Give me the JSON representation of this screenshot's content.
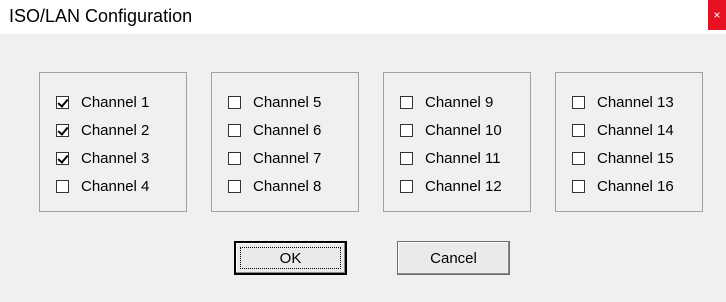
{
  "window": {
    "title": "ISO/LAN Configuration",
    "close_label": "×"
  },
  "groups": [
    {
      "channels": [
        {
          "label": "Channel 1",
          "checked": true
        },
        {
          "label": "Channel 2",
          "checked": true
        },
        {
          "label": "Channel 3",
          "checked": true
        },
        {
          "label": "Channel 4",
          "checked": false
        }
      ]
    },
    {
      "channels": [
        {
          "label": "Channel 5",
          "checked": false
        },
        {
          "label": "Channel 6",
          "checked": false
        },
        {
          "label": "Channel 7",
          "checked": false
        },
        {
          "label": "Channel 8",
          "checked": false
        }
      ]
    },
    {
      "channels": [
        {
          "label": "Channel 9",
          "checked": false
        },
        {
          "label": "Channel 10",
          "checked": false
        },
        {
          "label": "Channel 11",
          "checked": false
        },
        {
          "label": "Channel 12",
          "checked": false
        }
      ]
    },
    {
      "channels": [
        {
          "label": "Channel 13",
          "checked": false
        },
        {
          "label": "Channel 14",
          "checked": false
        },
        {
          "label": "Channel 15",
          "checked": false
        },
        {
          "label": "Channel 16",
          "checked": false
        }
      ]
    }
  ],
  "buttons": {
    "ok_label": "OK",
    "cancel_label": "Cancel"
  }
}
